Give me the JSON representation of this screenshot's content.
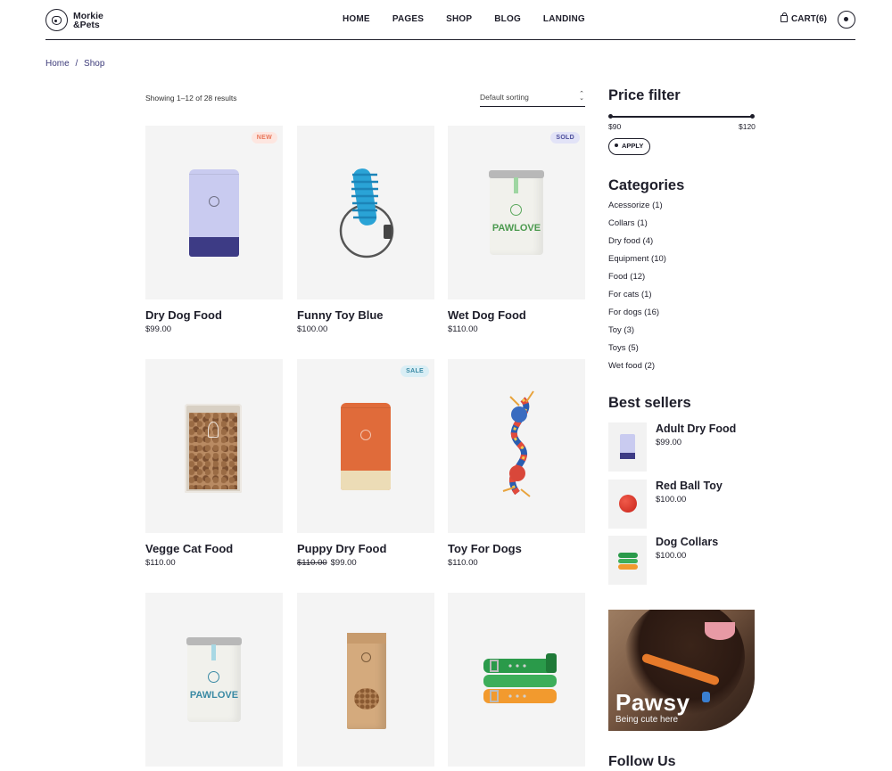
{
  "brand": {
    "name_line1": "Morkie",
    "name_line2": "&Pets"
  },
  "nav": [
    "HOME",
    "PAGES",
    "SHOP",
    "BLOG",
    "LANDING"
  ],
  "cart_label": "CART(6)",
  "breadcrumb": {
    "home": "Home",
    "separator": "/",
    "current": "Shop"
  },
  "toolbar": {
    "result_count": "Showing 1–12 of 28 results",
    "sort_label": "Default sorting",
    "sort_arrows": "⌃⌄"
  },
  "products": [
    {
      "name": "Dry Dog Food",
      "price": "$99.00",
      "badge": "NEW"
    },
    {
      "name": "Funny Toy Blue",
      "price": "$100.00"
    },
    {
      "name": "Wet Dog Food",
      "price": "$110.00",
      "badge": "SOLD",
      "can_text": "PAWLOVE"
    },
    {
      "name": "Vegge Cat Food",
      "price": "$110.00"
    },
    {
      "name": "Puppy Dry Food",
      "old_price": "$110.00",
      "price": "$99.00",
      "badge": "SALE"
    },
    {
      "name": "Toy For Dogs",
      "price": "$110.00"
    },
    {
      "name": "",
      "price": "",
      "can_text": "PAWLOVE"
    },
    {
      "name": "",
      "price": ""
    },
    {
      "name": "",
      "price": ""
    }
  ],
  "sidebar": {
    "price_filter": {
      "title": "Price filter",
      "min": "$90",
      "max": "$120",
      "apply": "APPLY"
    },
    "categories": {
      "title": "Categories",
      "items": [
        "Acessorize (1)",
        "Collars (1)",
        "Dry food (4)",
        "Equipment (10)",
        "Food (12)",
        "For cats (1)",
        "For dogs (16)",
        "Toy (3)",
        "Toys (5)",
        "Wet food (2)"
      ]
    },
    "best_sellers": {
      "title": "Best sellers",
      "items": [
        {
          "name": "Adult Dry Food",
          "price": "$99.00"
        },
        {
          "name": "Red Ball Toy",
          "price": "$100.00"
        },
        {
          "name": "Dog Collars",
          "price": "$100.00"
        }
      ]
    },
    "promo": {
      "title": "Pawsy",
      "subtitle": "Being cute here"
    },
    "follow_title": "Follow Us"
  },
  "colors": {
    "text": "#1e1e2a",
    "accent": "#3d3b7a",
    "tile_bg": "#f4f4f4",
    "badge_new": "#e8775a",
    "badge_sold": "#4a4c9a",
    "badge_sale": "#3a8aa4"
  }
}
